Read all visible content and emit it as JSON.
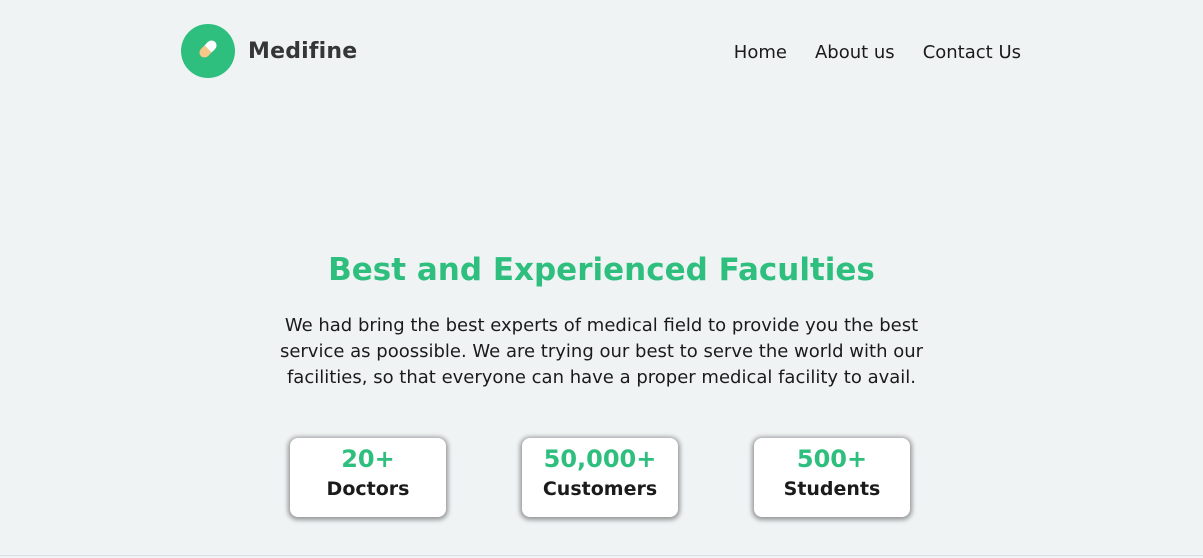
{
  "brand": {
    "name": "Medifine",
    "icon": "pill-icon",
    "badge_color": "#2ebf7e"
  },
  "nav": {
    "items": [
      "Home",
      "About us",
      "Contact Us"
    ]
  },
  "hero": {
    "title": "Best and Experienced Faculties",
    "description": "We had bring the best experts of medical field to provide you the best service as poossible. We are trying our best to serve the world with our facilities, so that everyone can have a proper medical facility to avail."
  },
  "stats": [
    {
      "value": "20+",
      "label": "Doctors"
    },
    {
      "value": "50,000+",
      "label": "Customers"
    },
    {
      "value": "500+",
      "label": "Students"
    }
  ],
  "colors": {
    "accent": "#2ebf7e",
    "background": "#eff3f4",
    "text": "#1b1b1b"
  }
}
